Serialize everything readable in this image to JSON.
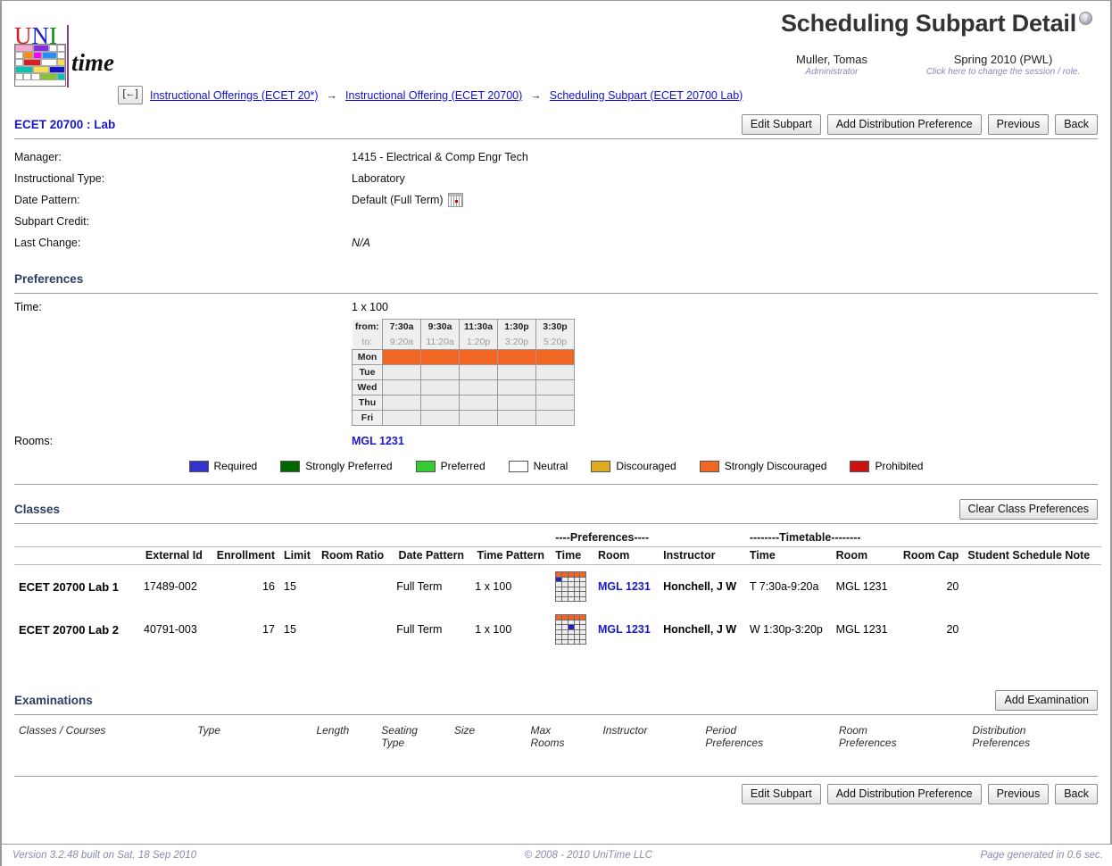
{
  "header": {
    "title": "Scheduling Subpart Detail",
    "help_icon": "help-icon",
    "user_name": "Muller, Tomas",
    "user_role": "Administrator",
    "session_name": "Spring 2010 (PWL)",
    "session_hint": "Click here to change the session / role.",
    "logo_uni": "UNI",
    "logo_time": "time"
  },
  "breadcrumb": {
    "back_label": "[←]",
    "separator": "→",
    "items": [
      "Instructional Offerings (ECET 20*)",
      "Instructional Offering (ECET 20700)",
      "Scheduling Subpart (ECET 20700 Lab)"
    ]
  },
  "subpart": {
    "heading": "ECET 20700 : Lab",
    "toolbar": [
      "Edit Subpart",
      "Add Distribution Preference",
      "Previous",
      "Back"
    ],
    "details": [
      {
        "label": "Manager:",
        "value": "1415 - Electrical & Comp Engr Tech",
        "italic": false,
        "icon": ""
      },
      {
        "label": "Instructional Type:",
        "value": "Laboratory",
        "italic": false,
        "icon": ""
      },
      {
        "label": "Date Pattern:",
        "value": "Default (Full Term)",
        "italic": false,
        "icon": "calendar-icon"
      },
      {
        "label": "Subpart Credit:",
        "value": "",
        "italic": false,
        "icon": ""
      },
      {
        "label": "Last Change:",
        "value": "N/A",
        "italic": true,
        "icon": ""
      }
    ]
  },
  "preferences": {
    "section_title": "Preferences",
    "time_label": "Time:",
    "pattern_name": "1 x 100",
    "grid": {
      "from_label": "from:",
      "to_label": "to:",
      "from_times": [
        "7:30a",
        "9:30a",
        "11:30a",
        "1:30p",
        "3:30p"
      ],
      "to_times": [
        "9:20a",
        "11:20a",
        "1:20p",
        "3:20p",
        "5:20p"
      ],
      "days": [
        "Mon",
        "Tue",
        "Wed",
        "Thu",
        "Fri"
      ],
      "cells": [
        [
          "sd",
          "sd",
          "sd",
          "sd",
          "sd"
        ],
        [
          "neutral",
          "neutral",
          "neutral",
          "neutral",
          "neutral"
        ],
        [
          "neutral",
          "neutral",
          "neutral",
          "neutral",
          "neutral"
        ],
        [
          "neutral",
          "neutral",
          "neutral",
          "neutral",
          "neutral"
        ],
        [
          "neutral",
          "neutral",
          "neutral",
          "neutral",
          "neutral"
        ]
      ]
    },
    "rooms_label": "Rooms:",
    "rooms_value": "MGL 1231"
  },
  "legend": [
    {
      "label": "Required",
      "color": "#3333cc"
    },
    {
      "label": "Strongly Preferred",
      "color": "#006600"
    },
    {
      "label": "Preferred",
      "color": "#33cc33"
    },
    {
      "label": "Neutral",
      "color": "#ffffff"
    },
    {
      "label": "Discouraged",
      "color": "#ddaa22"
    },
    {
      "label": "Strongly Discouraged",
      "color": "#f26522"
    },
    {
      "label": "Prohibited",
      "color": "#cc1111"
    }
  ],
  "classes": {
    "section_title": "Classes",
    "clear_button": "Clear Class Preferences",
    "group_headers": {
      "preferences": "----Preferences----",
      "timetable": "--------Timetable--------"
    },
    "columns": [
      "",
      "External Id",
      "Enrollment",
      "Limit",
      "Room Ratio",
      "Date Pattern",
      "Time Pattern",
      "Time",
      "Room",
      "Instructor",
      "Time",
      "Room",
      "Room Cap",
      "Student Schedule Note"
    ],
    "rows": [
      {
        "name": "ECET 20700 Lab 1",
        "external_id": "17489-002",
        "enrollment": "16",
        "limit": "15",
        "room_ratio": "",
        "date_pattern": "Full Term",
        "time_pattern": "1 x 100",
        "pref_grid": {
          "rows": 6,
          "cols": 5,
          "sd_cells": [
            [
              0,
              0
            ],
            [
              0,
              1
            ],
            [
              0,
              2
            ],
            [
              0,
              3
            ],
            [
              0,
              4
            ]
          ],
          "required_cells": [
            [
              1,
              0
            ]
          ]
        },
        "pref_room": "MGL 1231",
        "instructor": "Honchell, J W",
        "tt_time": "T 7:30a-9:20a",
        "tt_room": "MGL 1231",
        "room_cap": "20",
        "note": ""
      },
      {
        "name": "ECET 20700 Lab 2",
        "external_id": "40791-003",
        "enrollment": "17",
        "limit": "15",
        "room_ratio": "",
        "date_pattern": "Full Term",
        "time_pattern": "1 x 100",
        "pref_grid": {
          "rows": 6,
          "cols": 5,
          "sd_cells": [
            [
              0,
              0
            ],
            [
              0,
              1
            ],
            [
              0,
              2
            ],
            [
              0,
              3
            ],
            [
              0,
              4
            ]
          ],
          "required_cells": [
            [
              2,
              2
            ]
          ]
        },
        "pref_room": "MGL 1231",
        "instructor": "Honchell, J W",
        "tt_time": "W 1:30p-3:20p",
        "tt_room": "MGL 1231",
        "room_cap": "20",
        "note": ""
      }
    ]
  },
  "examinations": {
    "section_title": "Examinations",
    "add_button": "Add Examination",
    "columns": [
      "Classes / Courses",
      "Type",
      "Length",
      "Seating\nType",
      "Size",
      "Max\nRooms",
      "Instructor",
      "Period\nPreferences",
      "Room\nPreferences",
      "Distribution\nPreferences"
    ]
  },
  "bottom_toolbar": [
    "Edit Subpart",
    "Add Distribution Preference",
    "Previous",
    "Back"
  ],
  "footer": {
    "version": "Version 3.2.48 built on Sat, 18 Sep 2010",
    "copyright": "© 2008 - 2010 UniTime LLC",
    "generated": "Page generated in 0.6 sec."
  }
}
